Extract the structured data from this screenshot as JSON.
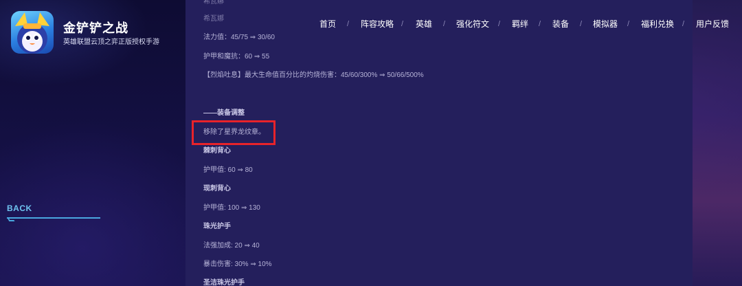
{
  "brand": {
    "title": "金铲铲之战",
    "subtitle": "英雄联盟云顶之弈正版授权手游"
  },
  "nav": {
    "items": [
      "首页",
      "阵容攻略",
      "英雄",
      "强化符文",
      "羁绊",
      "装备",
      "模拟器",
      "福利兑换",
      "用户反馈"
    ],
    "separator": "/"
  },
  "back": {
    "label": "BACK"
  },
  "article": {
    "lines": [
      {
        "text": "希瓦娜",
        "style": "faded"
      },
      {
        "text": "法力值：45/75 ⇒ 30/60",
        "style": "normal"
      },
      {
        "text": "护甲和魔抗：60 ⇒ 55",
        "style": "normal"
      },
      {
        "text": "【烈焰吐息】最大生命值百分比的灼烧伤害：45/60/300% ⇒ 50/66/500%",
        "style": "normal"
      },
      {
        "text": "——装备调整",
        "style": "bold"
      },
      {
        "text": "移除了星界龙纹章。",
        "style": "normal"
      },
      {
        "text": "棘刺背心",
        "style": "bold"
      },
      {
        "text": "护甲值: 60 ⇒ 80",
        "style": "normal"
      },
      {
        "text": "现刺背心",
        "style": "bold"
      },
      {
        "text": "护甲值: 100 ⇒ 130",
        "style": "normal"
      },
      {
        "text": "珠光护手",
        "style": "bold"
      },
      {
        "text": "法强加成: 20 ⇒ 40",
        "style": "normal"
      },
      {
        "text": "暴击伤害: 30% ⇒ 10%",
        "style": "normal"
      },
      {
        "text": "圣洁珠光护手",
        "style": "bold"
      }
    ]
  },
  "colors": {
    "highlight_border": "#e8232a",
    "back_accent": "#4aa8e0",
    "content_bg": "#241f5c"
  }
}
